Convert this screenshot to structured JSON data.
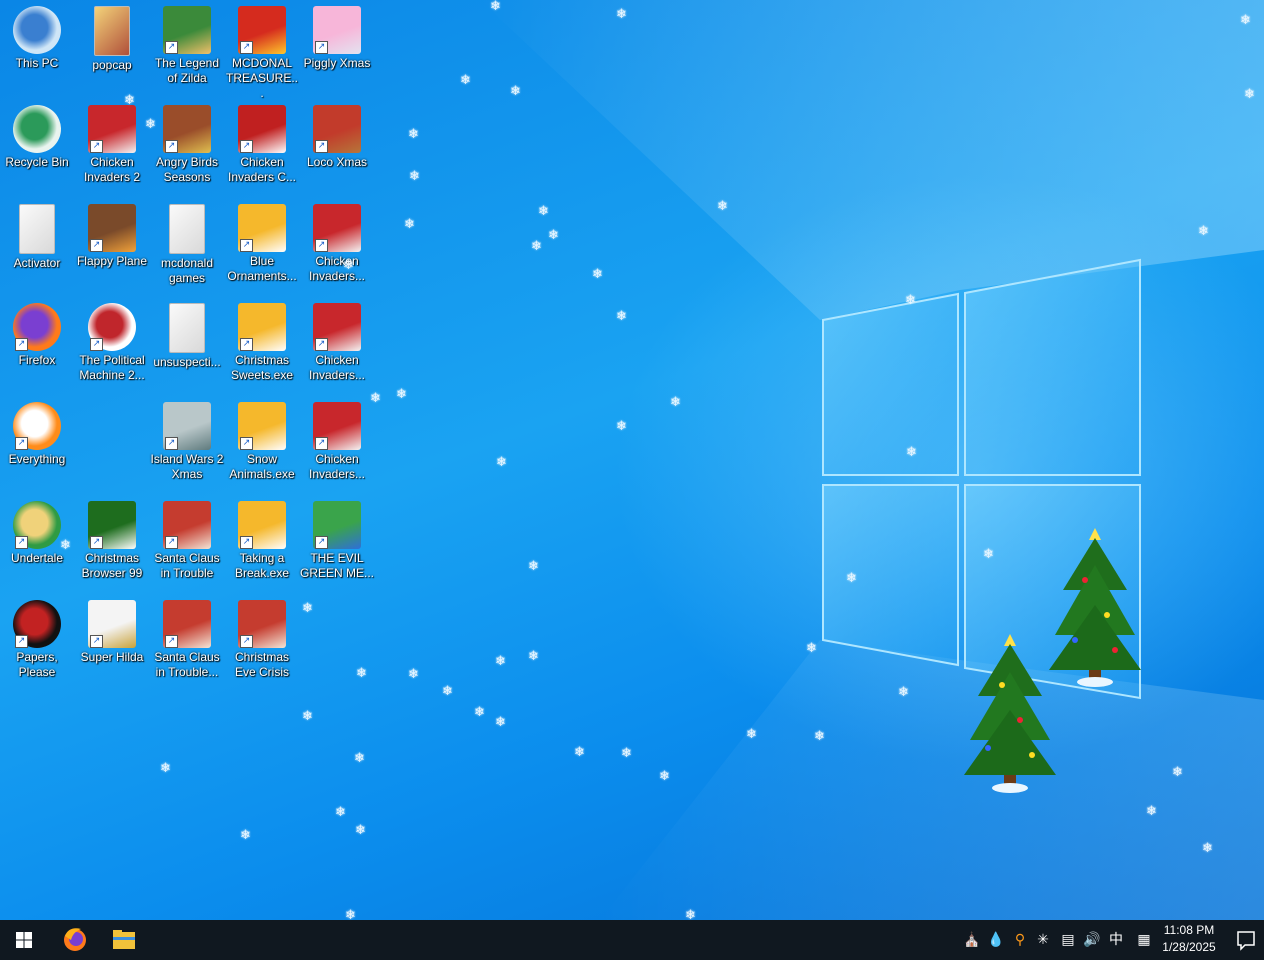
{
  "desktop": {
    "icons": [
      {
        "label": "This PC",
        "icon": "this-pc-icon"
      },
      {
        "label": "popcap",
        "icon": "folder-icon"
      },
      {
        "label": "The Legend of Zilda",
        "icon": "game-icon"
      },
      {
        "label": "MCDONAL TREASURE...",
        "icon": "mcdonalds-icon"
      },
      {
        "label": "Piggly Xmas",
        "icon": "pig-icon"
      },
      {
        "label": "Recycle Bin",
        "icon": "recycle-bin-icon"
      },
      {
        "label": "Chicken Invaders 2",
        "icon": "chicken-icon"
      },
      {
        "label": "Angry Birds Seasons",
        "icon": "angry-birds-icon"
      },
      {
        "label": "Chicken Invaders C...",
        "icon": "snowman-icon"
      },
      {
        "label": "Loco Xmas",
        "icon": "bear-icon"
      },
      {
        "label": "Activator",
        "icon": "file-icon"
      },
      {
        "label": "Flappy Plane",
        "icon": "plane-icon"
      },
      {
        "label": "mcdonald games",
        "icon": "file-icon"
      },
      {
        "label": "Blue Ornaments...",
        "icon": "puzzle-icon"
      },
      {
        "label": "Chicken Invaders...",
        "icon": "chicken-icon"
      },
      {
        "label": "Firefox",
        "icon": "firefox-icon"
      },
      {
        "label": "The Political Machine 2...",
        "icon": "political-machine-icon"
      },
      {
        "label": "unsuspecti...",
        "icon": "file-icon"
      },
      {
        "label": "Christmas Sweets.exe",
        "icon": "puzzle-icon"
      },
      {
        "label": "Chicken Invaders...",
        "icon": "chicken-icon"
      },
      {
        "label": "Everything",
        "icon": "everything-search-icon"
      },
      {
        "label": "Island Wars 2 Xmas",
        "icon": "island-icon"
      },
      {
        "label": "Snow Animals.exe",
        "icon": "puzzle-icon"
      },
      {
        "label": "Chicken Invaders...",
        "icon": "chicken-icon"
      },
      {
        "label": "Undertale",
        "icon": "undertale-icon"
      },
      {
        "label": "Christmas Browser 99",
        "icon": "christmas-tree-icon"
      },
      {
        "label": "Santa Claus in Trouble",
        "icon": "santa-icon"
      },
      {
        "label": "Taking a Break.exe",
        "icon": "puzzle-icon"
      },
      {
        "label": "THE EVIL GREEN ME...",
        "icon": "messenger-icon"
      },
      {
        "label": "Papers, Please",
        "icon": "papers-please-icon"
      },
      {
        "label": "Super Hilda",
        "icon": "hilda-icon"
      },
      {
        "label": "Santa Claus in Trouble...",
        "icon": "santa-icon"
      },
      {
        "label": "Christmas Eve Crisis",
        "icon": "santa-icon"
      }
    ]
  },
  "taskbar": {
    "start_icon": "windows-start-icon",
    "pinned": [
      {
        "name": "firefox-taskbar-icon"
      },
      {
        "name": "file-explorer-taskbar-icon"
      }
    ],
    "tray": {
      "ime_label": "中",
      "time": "11:08 PM",
      "date": "1/28/2025"
    }
  },
  "colors": {
    "taskbar": "#101820",
    "wallpaper": "#1a9cf0"
  }
}
